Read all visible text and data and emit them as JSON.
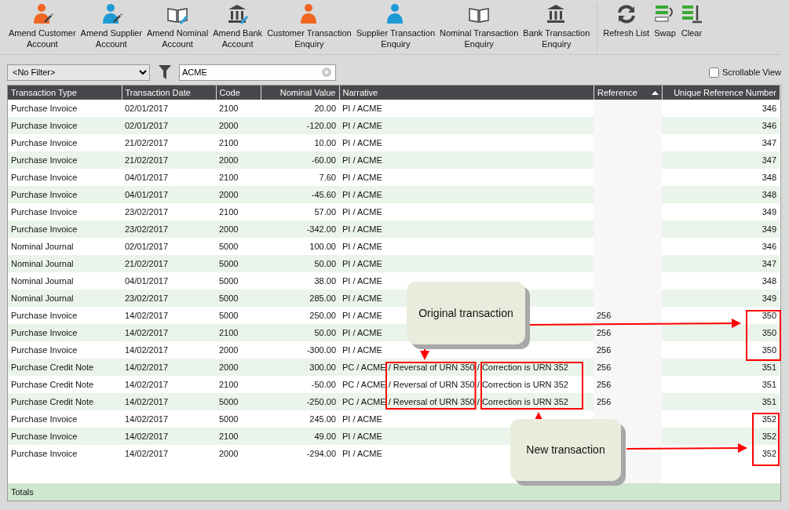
{
  "toolbar": {
    "groups": [
      {
        "buttons": [
          {
            "label": "Amend Customer\nAccount"
          },
          {
            "label": "Amend Supplier\nAccount"
          },
          {
            "label": "Amend Nominal\nAccount"
          },
          {
            "label": "Amend Bank\nAccount"
          },
          {
            "label": "Customer Transaction\nEnquiry"
          },
          {
            "label": "Supplier Transaction\nEnquiry"
          },
          {
            "label": "Nominal Transaction\nEnquiry"
          },
          {
            "label": "Bank Transaction\nEnquiry"
          }
        ]
      },
      {
        "buttons": [
          {
            "label": "Refresh List"
          },
          {
            "label": "Swap"
          },
          {
            "label": "Clear"
          }
        ]
      }
    ]
  },
  "filter": {
    "value": "<No Filter>"
  },
  "search": {
    "value": "ACME"
  },
  "scrollable_view": {
    "label": "Scrollable View",
    "checked": false
  },
  "table": {
    "columns": [
      {
        "label": "Transaction Type",
        "sorted": false
      },
      {
        "label": "Transaction Date",
        "sorted": false
      },
      {
        "label": "Code",
        "sorted": false
      },
      {
        "label": "Nominal Value",
        "sorted": false
      },
      {
        "label": "Narrative",
        "sorted": false
      },
      {
        "label": "Reference",
        "sorted": true
      },
      {
        "label": "Unique Reference Number",
        "sorted": false
      }
    ],
    "rows": [
      [
        "Purchase Invoice",
        "02/01/2017",
        "2100",
        "20.00",
        "PI / ACME",
        "",
        "346"
      ],
      [
        "Purchase Invoice",
        "02/01/2017",
        "2000",
        "-120.00",
        "PI / ACME",
        "",
        "346"
      ],
      [
        "Purchase Invoice",
        "21/02/2017",
        "2100",
        "10.00",
        "PI / ACME",
        "",
        "347"
      ],
      [
        "Purchase Invoice",
        "21/02/2017",
        "2000",
        "-60.00",
        "PI / ACME",
        "",
        "347"
      ],
      [
        "Purchase Invoice",
        "04/01/2017",
        "2100",
        "7.60",
        "PI / ACME",
        "",
        "348"
      ],
      [
        "Purchase Invoice",
        "04/01/2017",
        "2000",
        "-45.60",
        "PI / ACME",
        "",
        "348"
      ],
      [
        "Purchase Invoice",
        "23/02/2017",
        "2100",
        "57.00",
        "PI / ACME",
        "",
        "349"
      ],
      [
        "Purchase Invoice",
        "23/02/2017",
        "2000",
        "-342.00",
        "PI / ACME",
        "",
        "349"
      ],
      [
        "Nominal Journal",
        "02/01/2017",
        "5000",
        "100.00",
        "PI / ACME",
        "",
        "346"
      ],
      [
        "Nominal Journal",
        "21/02/2017",
        "5000",
        "50.00",
        "PI / ACME",
        "",
        "347"
      ],
      [
        "Nominal Journal",
        "04/01/2017",
        "5000",
        "38.00",
        "PI / ACME",
        "",
        "348"
      ],
      [
        "Nominal Journal",
        "23/02/2017",
        "5000",
        "285.00",
        "PI / ACME",
        "",
        "349"
      ],
      [
        "Purchase Invoice",
        "14/02/2017",
        "5000",
        "250.00",
        "PI / ACME",
        "256",
        "350"
      ],
      [
        "Purchase Invoice",
        "14/02/2017",
        "2100",
        "50.00",
        "PI / ACME",
        "256",
        "350"
      ],
      [
        "Purchase Invoice",
        "14/02/2017",
        "2000",
        "-300.00",
        "PI / ACME",
        "256",
        "350"
      ],
      [
        "Purchase Credit Note",
        "14/02/2017",
        "2000",
        "300.00",
        "PC / ACME / Reversal of URN 350 / Correction is URN 352",
        "256",
        "351"
      ],
      [
        "Purchase Credit Note",
        "14/02/2017",
        "2100",
        "-50.00",
        "PC / ACME / Reversal of URN 350 / Correction is URN 352",
        "256",
        "351"
      ],
      [
        "Purchase Credit Note",
        "14/02/2017",
        "5000",
        "-250.00",
        "PC / ACME / Reversal of URN 350 / Correction is URN 352",
        "256",
        "351"
      ],
      [
        "Purchase Invoice",
        "14/02/2017",
        "5000",
        "245.00",
        "PI / ACME",
        "",
        "352"
      ],
      [
        "Purchase Invoice",
        "14/02/2017",
        "2100",
        "49.00",
        "PI / ACME",
        "",
        "352"
      ],
      [
        "Purchase Invoice",
        "14/02/2017",
        "2000",
        "-294.00",
        "PI / ACME",
        "",
        "352"
      ]
    ],
    "totals_label": "Totals"
  },
  "annotations": [
    {
      "text": "Original transaction"
    },
    {
      "text": "New transaction"
    }
  ]
}
